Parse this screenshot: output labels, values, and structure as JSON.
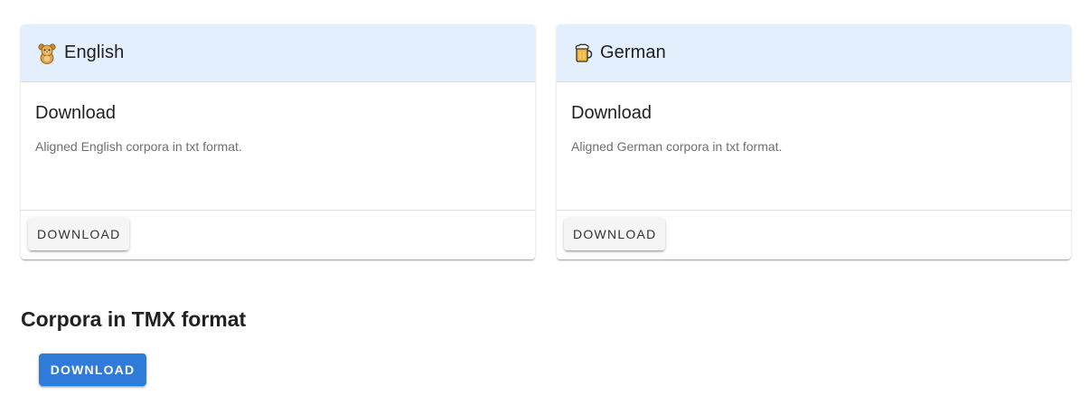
{
  "cards": [
    {
      "icon": "teddy-bear-icon",
      "title": "English",
      "subtitle": "Download",
      "description": "Aligned English corpora in txt format.",
      "button_label": "Download"
    },
    {
      "icon": "beer-mug-icon",
      "title": "German",
      "subtitle": "Download",
      "description": "Aligned German corpora in txt format.",
      "button_label": "Download"
    }
  ],
  "tmx": {
    "heading": "Corpora in TMX format",
    "button_label": "Download"
  },
  "colors": {
    "card_header_bg": "#e3effc",
    "primary_button": "#2f7bd9",
    "flat_button": "#f5f5f5"
  }
}
